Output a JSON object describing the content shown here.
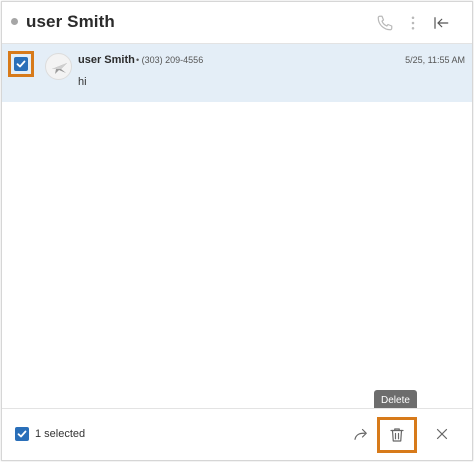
{
  "header": {
    "title": "user Smith",
    "presence_color": "#a6a6a6",
    "icons": [
      "phone-icon",
      "more-vertical-icon",
      "collapse-panel-icon"
    ]
  },
  "message": {
    "selected": true,
    "sender": "user Smith",
    "phone": "• (303) 209-4556",
    "time": "5/25, 11:55 AM",
    "body": "hi",
    "row_color": "#e4eef7"
  },
  "footer": {
    "selected_label": "1 selected",
    "tooltip": "Delete",
    "icons": [
      "forward-icon",
      "trash-icon",
      "close-icon"
    ]
  },
  "colors": {
    "accent": "#2a6fb9",
    "highlight": "#d77a1a"
  }
}
